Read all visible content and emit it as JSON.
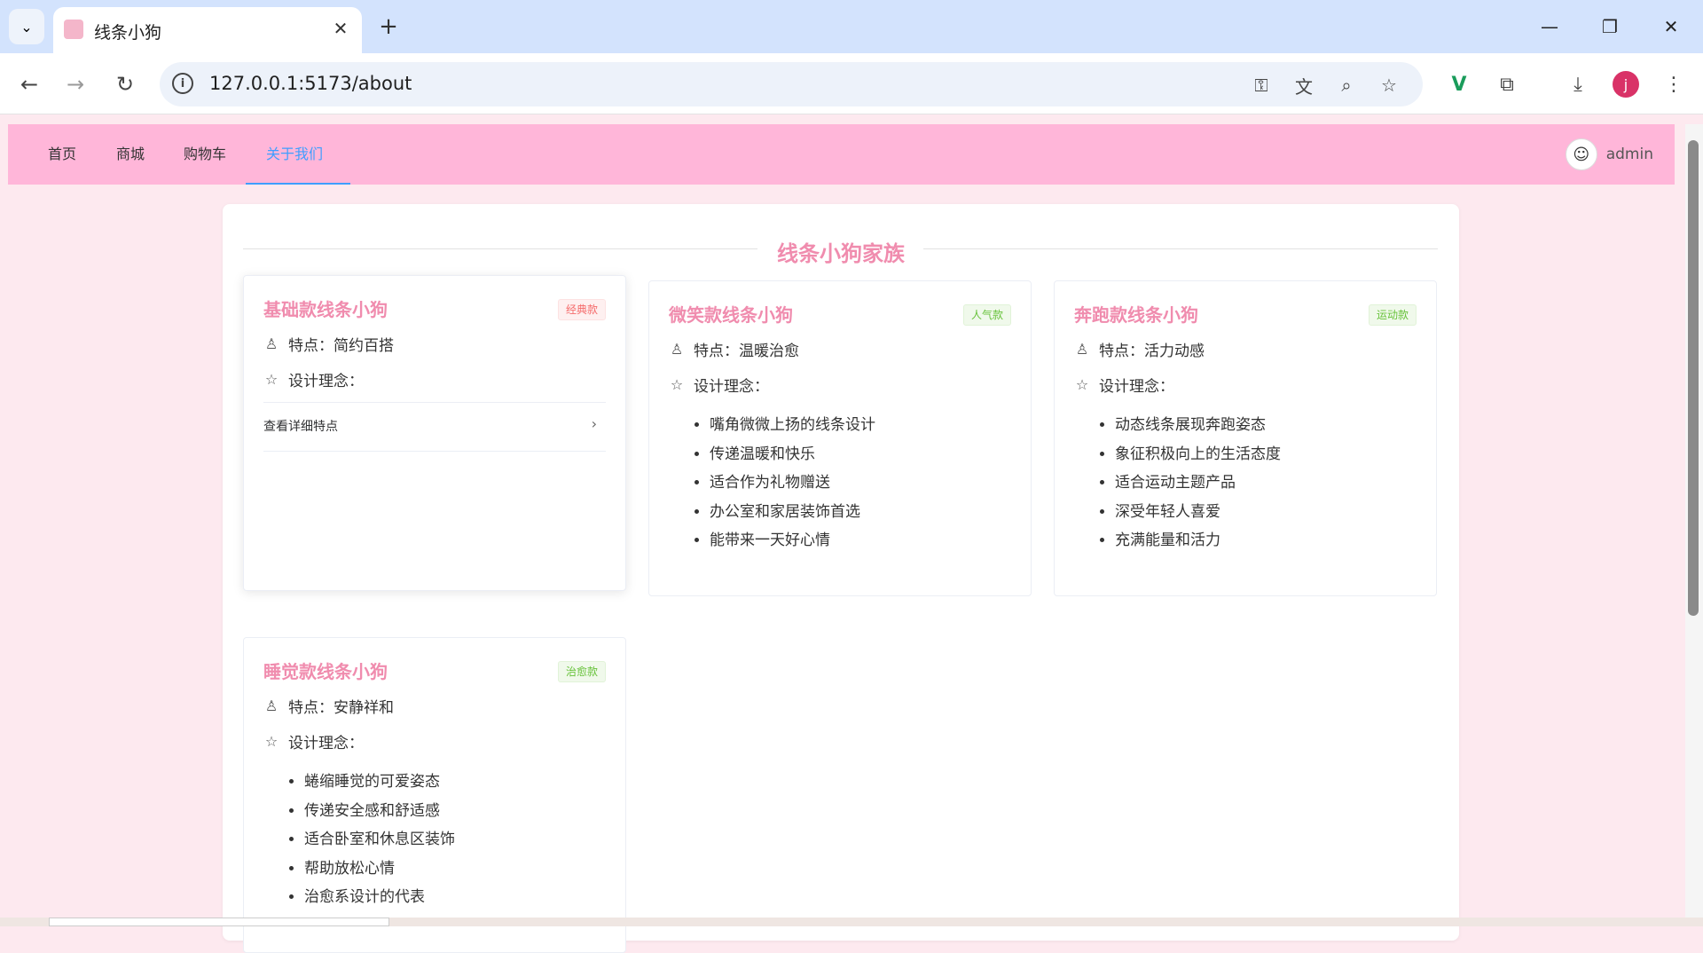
{
  "browser": {
    "tab_title": "线条小狗",
    "url": "127.0.0.1:5173/about",
    "profile_initial": "j"
  },
  "nav": {
    "items": [
      "首页",
      "商城",
      "购物车",
      "关于我们"
    ],
    "active": "关于我们",
    "username": "admin"
  },
  "section_title": "线条小狗家族",
  "labels": {
    "feature_prefix": "特点：",
    "design_concept": "设计理念：",
    "view_details": "查看详细特点"
  },
  "cards": [
    {
      "name": "基础款线条小狗",
      "tag": "经典款",
      "tag_color": "#f56c6c",
      "feature": "简约百搭",
      "concepts": []
    },
    {
      "name": "微笑款线条小狗",
      "tag": "人气款",
      "tag_color": "#67c23a",
      "feature": "温暖治愈",
      "concepts": [
        "嘴角微微上扬的线条设计",
        "传递温暖和快乐",
        "适合作为礼物赠送",
        "办公室和家居装饰首选",
        "能带来一天好心情"
      ]
    },
    {
      "name": "奔跑款线条小狗",
      "tag": "运动款",
      "tag_color": "#67c23a",
      "feature": "活力动感",
      "concepts": [
        "动态线条展现奔跑姿态",
        "象征积极向上的生活态度",
        "适合运动主题产品",
        "深受年轻人喜爱",
        "充满能量和活力"
      ]
    },
    {
      "name": "睡觉款线条小狗",
      "tag": "治愈款",
      "tag_color": "#67c23a",
      "feature": "安静祥和",
      "concepts": [
        "蜷缩睡觉的可爱姿态",
        "传递安全感和舒适感",
        "适合卧室和休息区装饰",
        "帮助放松心情",
        "治愈系设计的代表"
      ]
    }
  ],
  "colors": {
    "nav_bg": "#ffb6d9",
    "accent": "#f08cae",
    "active_link": "#409eff",
    "page_bg": "#fde9ef"
  }
}
